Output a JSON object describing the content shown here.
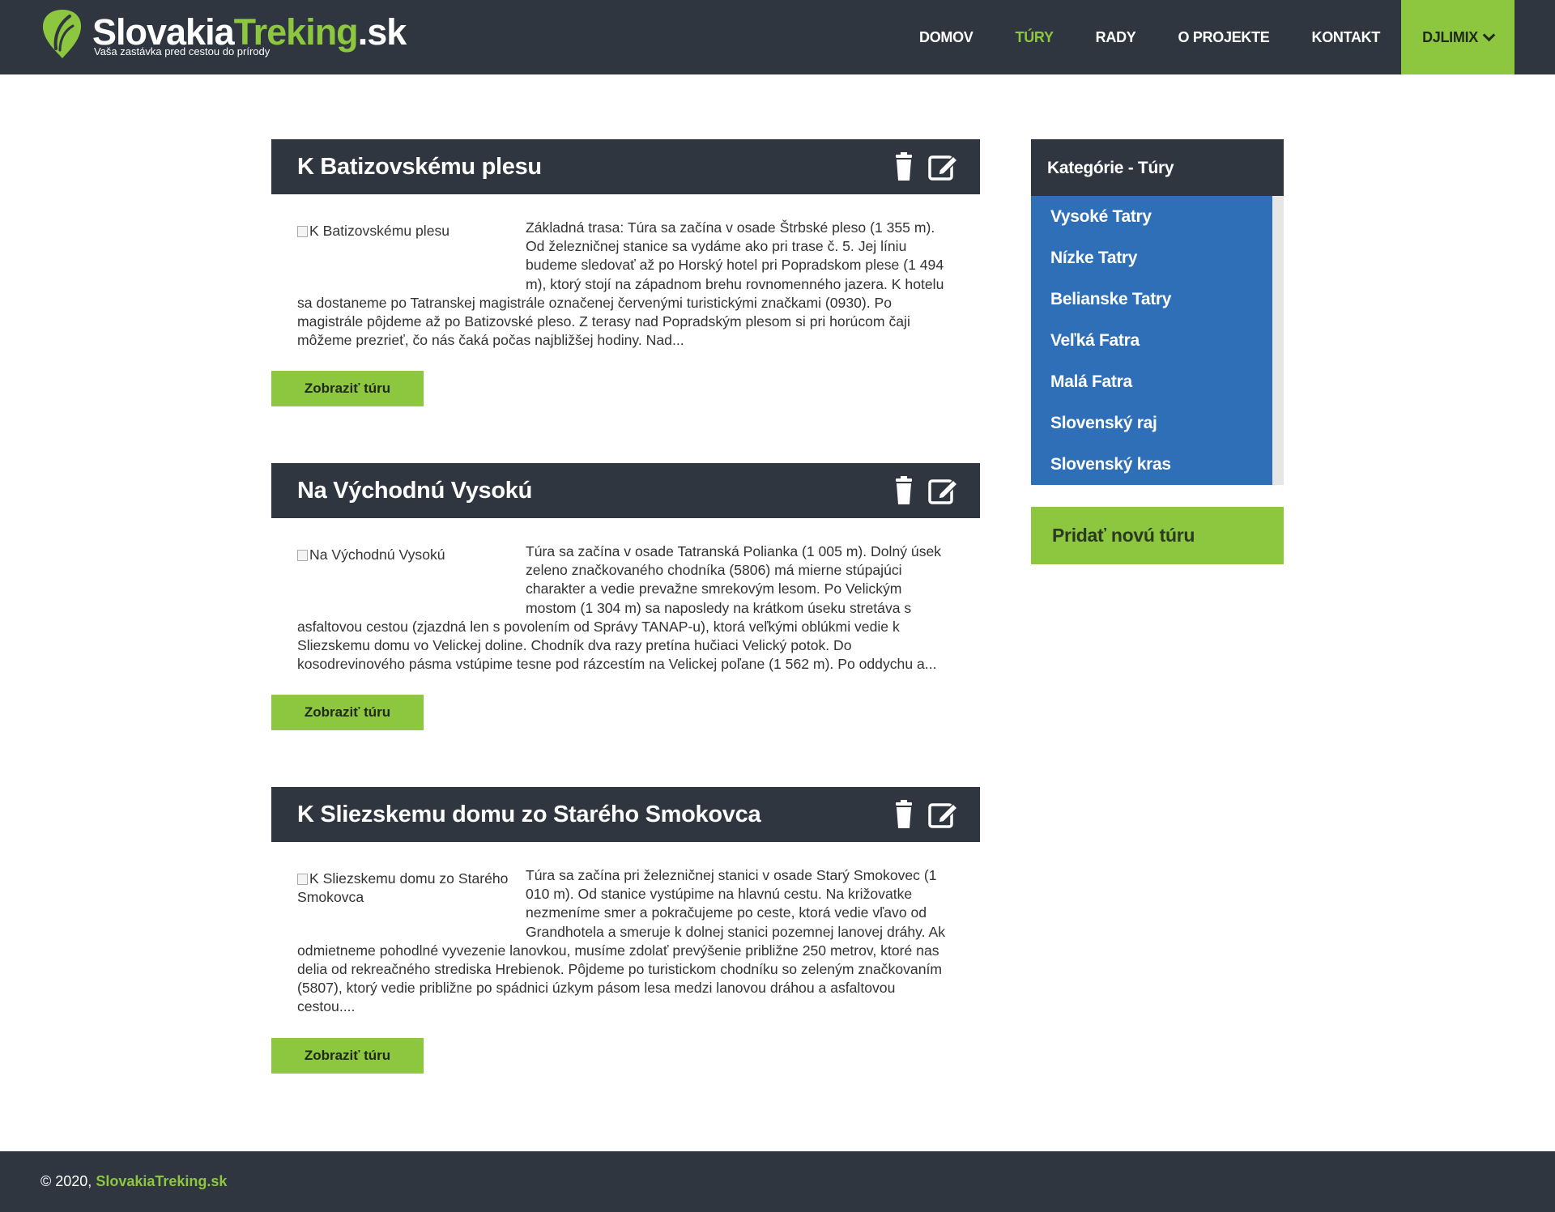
{
  "brand": {
    "name_part1": "Slovakia",
    "name_part2": "Treking",
    "name_part3": ".sk",
    "tagline": "Vaša zastávka pred cestou do prírody",
    "accent_color": "#8dc63f",
    "dark_color": "#2f3640"
  },
  "nav": {
    "items": [
      {
        "label": "DOMOV",
        "active": false
      },
      {
        "label": "TÚRY",
        "active": true
      },
      {
        "label": "RADY",
        "active": false
      },
      {
        "label": "O PROJEKTE",
        "active": false
      },
      {
        "label": "KONTAKT",
        "active": false
      }
    ],
    "user_label": "DJLIMIX",
    "user_icon": "chevron-down-icon"
  },
  "tours": [
    {
      "title": "K Batizovskému plesu",
      "image_alt": "K Batizovskému plesu",
      "excerpt": "Základná trasa: Túra sa začína v osade Štrbské pleso (1 355 m). Od železničnej stanice sa vydáme ako pri trase č. 5. Jej líniu budeme sledovať až po Horský hotel pri Popradskom plese (1 494 m), ktorý stojí na západnom brehu rovnomenného jazera. K hotelu sa dostaneme po Tatranskej magistrále označenej červenými turistickými značkami (0930). Po magistrále pôjdeme až po Batizovské pleso. Z terasy nad Popradským plesom si pri horúcom čaji môžeme prezrieť, čo nás čaká počas najbližšej hodiny. Nad...",
      "button_label": "Zobraziť túru"
    },
    {
      "title": "Na Východnú Vysokú",
      "image_alt": "Na Východnú Vysokú",
      "excerpt": "Túra sa začína v osade Tatranská Polianka (1 005 m). Dolný úsek zeleno značkovaného chodníka (5806) má mierne stúpajúci charakter a vedie prevažne smrekovým lesom. Po Velickým mostom (1 304 m) sa naposledy na krátkom úseku stretáva s asfaltovou cestou (zjazdná len s povolením od Správy TANAP-u), ktorá veľkými oblúkmi vedie k Sliezskemu domu vo Velickej doline. Chodník dva razy pretína hučiaci Velický potok. Do kosodrevinového pásma vstúpime tesne pod rázcestím na Velickej poľane (1 562 m). Po oddychu a...",
      "button_label": "Zobraziť túru"
    },
    {
      "title": "K Sliezskemu domu zo Starého Smokovca",
      "image_alt": "K Sliezskemu domu zo Starého Smokovca",
      "excerpt": "Túra sa začína pri železničnej stanici v osade Starý Smokovec (1 010 m). Od stanice vystúpime na hlavnú cestu. Na križovatke nezmeníme smer a pokračujeme po ceste, ktorá vedie vľavo od Grandhotela a smeruje k dolnej stanici pozemnej lanovej dráhy. Ak odmietneme pohodlné vyvezenie lanovkou, musíme zdolať prevýšenie približne 250 metrov, ktoré nas delia od rekreačného strediska Hrebienok. Pôjdeme po turistickom chodníku so zeleným značkovaním (5807), ktorý vedie približne po spádnici úzkym pásom lesa medzi lanovou dráhou a asfaltovou cestou....",
      "button_label": "Zobraziť túru"
    }
  ],
  "sidebar": {
    "title": "Kategórie - Túry",
    "categories": [
      "Vysoké Tatry",
      "Nízke Tatry",
      "Belianske Tatry",
      "Veľká Fatra",
      "Malá Fatra",
      "Slovenský raj",
      "Slovenský kras"
    ],
    "list_color": "#2e6fb7",
    "add_button_label": "Pridať novú túru"
  },
  "footer": {
    "copyright": "© 2020, ",
    "brand": "SlovakiaTreking.sk"
  }
}
